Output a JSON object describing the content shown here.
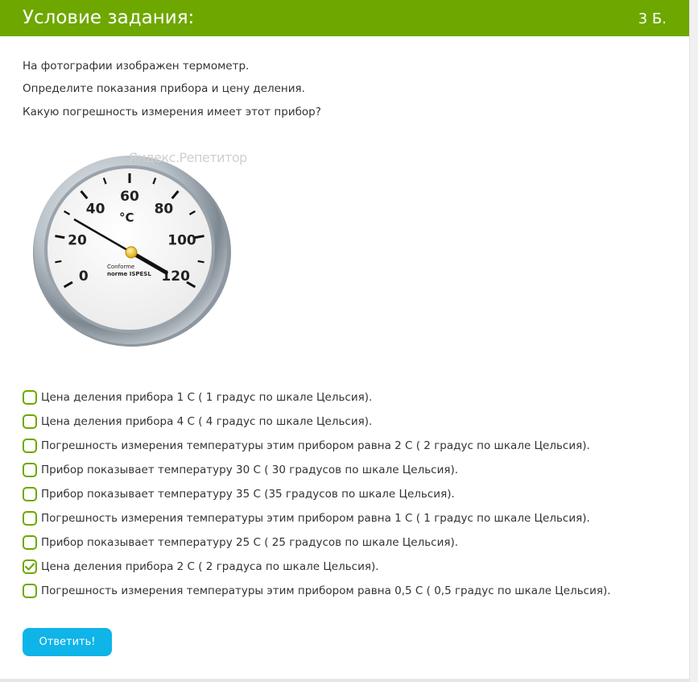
{
  "header": {
    "title": "Условие задания:",
    "points": "3 Б."
  },
  "question": {
    "lines": [
      "На фотографии изображен термометр.",
      "Определите показания прибора и цену деления.",
      "Какую погрешность измерения имеет этот прибор?"
    ]
  },
  "image": {
    "watermark": "Яндекс.Репетитор",
    "gauge": {
      "unit": "°C",
      "scale_labels": [
        "0",
        "20",
        "40",
        "60",
        "80",
        "100",
        "120"
      ],
      "brand_line1": "Conforme",
      "brand_line2": "norme ISPESL",
      "pointer_reading": 30,
      "scale_min": 0,
      "scale_max": 120
    }
  },
  "options": [
    {
      "label": "Цена деления прибора 1 С ( 1 градус по шкале Цельсия).",
      "checked": false
    },
    {
      "label": "Цена деления прибора 4 С ( 4 градус по шкале Цельсия).",
      "checked": false
    },
    {
      "label": "Погрешность измерения температуры этим прибором равна 2 С ( 2 градус по шкале Цельсия).",
      "checked": false
    },
    {
      "label": "Прибор показывает температуру 30 С ( 30 градусов по шкале Цельсия).",
      "checked": false
    },
    {
      "label": "Прибор показывает температуру 35 С (35 градусов по шкале Цельсия).",
      "checked": false
    },
    {
      "label": "Погрешность измерения температуры этим прибором равна 1 С ( 1 градус по шкале Цельсия).",
      "checked": false
    },
    {
      "label": "Прибор показывает температуру 25 С ( 25 градусов по шкале Цельсия).",
      "checked": false
    },
    {
      "label": "Цена деления прибора 2 С ( 2 градуса по шкале Цельсия).",
      "checked": true
    },
    {
      "label": "Погрешность измерения температуры этим прибором равна 0,5 С ( 0,5 градус по шкале Цельсия).",
      "checked": false
    }
  ],
  "submit": {
    "label": "Ответить!"
  },
  "colors": {
    "header_bg": "#6ea700",
    "checkbox_border": "#6ea700",
    "button_bg": "#0fb4e8"
  }
}
